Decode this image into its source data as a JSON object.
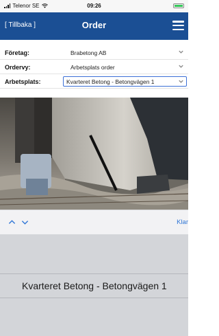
{
  "status_bar": {
    "carrier": "Telenor SE",
    "time": "09:26",
    "battery_color": "#35c759"
  },
  "nav": {
    "back_label": "[ Tillbaka ]",
    "title": "Order",
    "menu_icon": "hamburger-menu-icon",
    "bar_color": "#1b4f94"
  },
  "form": {
    "company_label": "Företag:",
    "company_value": "Brabetong AB",
    "order_view_label": "Ordervy:",
    "order_view_value": "Arbetsplats order",
    "workplace_label": "Arbetsplats:",
    "workplace_value": "Kvarteret Betong - Betongvägen 1"
  },
  "toolbar": {
    "prev_icon": "chevron-up-icon",
    "next_icon": "chevron-down-icon",
    "done_label": "Klar",
    "done_color": "#2f76d6"
  },
  "picker": {
    "options": [
      "Kvarteret Betong - Betongvägen 1"
    ]
  }
}
